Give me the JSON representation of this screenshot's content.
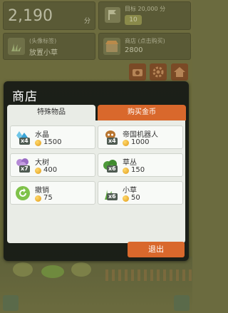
{
  "hud": {
    "score": "2,190",
    "score_unit": "分",
    "target_label": "目标 20,000 分",
    "target_badge": "10"
  },
  "panels": {
    "grass_line1": "(头像标签)",
    "grass_line2": "放置小草",
    "shop_line1": "商店 (点击购买)",
    "shop_line2": "2800"
  },
  "dialog": {
    "title": "商店",
    "tabs": [
      {
        "label": "特殊物品",
        "active": true
      },
      {
        "label": "购买金币",
        "active": false
      }
    ],
    "items": [
      {
        "name": "水晶",
        "qty": "x4",
        "price": "1500",
        "icon": "crystal-icon"
      },
      {
        "name": "帝国机器人",
        "qty": "x4",
        "price": "1000",
        "icon": "robot-icon"
      },
      {
        "name": "大树",
        "qty": "x7",
        "price": "400",
        "icon": "tree-icon"
      },
      {
        "name": "草丛",
        "qty": "x6",
        "price": "150",
        "icon": "bush-icon"
      },
      {
        "name": "撤销",
        "qty": "",
        "price": "75",
        "icon": "undo-icon"
      },
      {
        "name": "小草",
        "qty": "x6",
        "price": "50",
        "icon": "grass-icon"
      }
    ],
    "exit_label": "退出"
  },
  "colors": {
    "accent": "#d9682c",
    "dialog_bg": "#161a16",
    "content_bg": "#e9ece6",
    "coin": "#e09a1a"
  }
}
